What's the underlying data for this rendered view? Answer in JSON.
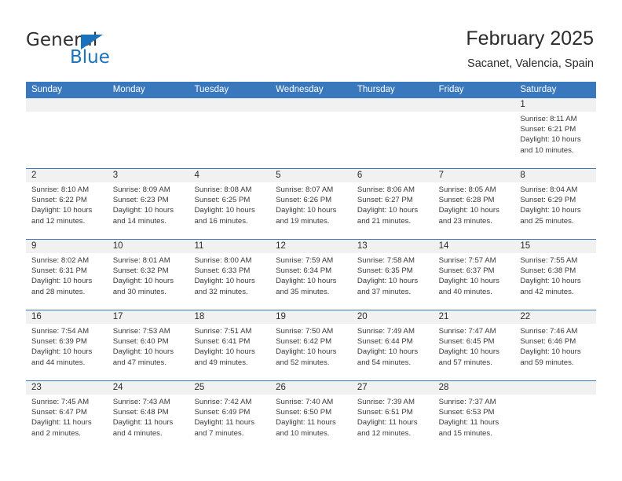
{
  "brand": {
    "name_part1": "General",
    "name_part2": "Blue",
    "triangle_color": "#1a72bb",
    "text_color": "#2f2f2f"
  },
  "header": {
    "title": "February 2025",
    "subtitle": "Sacanet, Valencia, Spain"
  },
  "colors": {
    "header_blue": "#3a78bd",
    "daynum_band": "#f1f1f1",
    "cell_background": "#ffffff",
    "text": "#3a3a3a"
  },
  "calendar": {
    "weekday_headers": [
      "Sunday",
      "Monday",
      "Tuesday",
      "Wednesday",
      "Thursday",
      "Friday",
      "Saturday"
    ],
    "weeks": [
      [
        {
          "day": "",
          "sunrise": "",
          "sunset": "",
          "daylight_line1": "",
          "daylight_line2": "",
          "empty": true
        },
        {
          "day": "",
          "sunrise": "",
          "sunset": "",
          "daylight_line1": "",
          "daylight_line2": "",
          "empty": true
        },
        {
          "day": "",
          "sunrise": "",
          "sunset": "",
          "daylight_line1": "",
          "daylight_line2": "",
          "empty": true
        },
        {
          "day": "",
          "sunrise": "",
          "sunset": "",
          "daylight_line1": "",
          "daylight_line2": "",
          "empty": true
        },
        {
          "day": "",
          "sunrise": "",
          "sunset": "",
          "daylight_line1": "",
          "daylight_line2": "",
          "empty": true
        },
        {
          "day": "",
          "sunrise": "",
          "sunset": "",
          "daylight_line1": "",
          "daylight_line2": "",
          "empty": true
        },
        {
          "day": "1",
          "sunrise": "Sunrise: 8:11 AM",
          "sunset": "Sunset: 6:21 PM",
          "daylight_line1": "Daylight: 10 hours",
          "daylight_line2": "and 10 minutes.",
          "empty": false
        }
      ],
      [
        {
          "day": "2",
          "sunrise": "Sunrise: 8:10 AM",
          "sunset": "Sunset: 6:22 PM",
          "daylight_line1": "Daylight: 10 hours",
          "daylight_line2": "and 12 minutes.",
          "empty": false
        },
        {
          "day": "3",
          "sunrise": "Sunrise: 8:09 AM",
          "sunset": "Sunset: 6:23 PM",
          "daylight_line1": "Daylight: 10 hours",
          "daylight_line2": "and 14 minutes.",
          "empty": false
        },
        {
          "day": "4",
          "sunrise": "Sunrise: 8:08 AM",
          "sunset": "Sunset: 6:25 PM",
          "daylight_line1": "Daylight: 10 hours",
          "daylight_line2": "and 16 minutes.",
          "empty": false
        },
        {
          "day": "5",
          "sunrise": "Sunrise: 8:07 AM",
          "sunset": "Sunset: 6:26 PM",
          "daylight_line1": "Daylight: 10 hours",
          "daylight_line2": "and 19 minutes.",
          "empty": false
        },
        {
          "day": "6",
          "sunrise": "Sunrise: 8:06 AM",
          "sunset": "Sunset: 6:27 PM",
          "daylight_line1": "Daylight: 10 hours",
          "daylight_line2": "and 21 minutes.",
          "empty": false
        },
        {
          "day": "7",
          "sunrise": "Sunrise: 8:05 AM",
          "sunset": "Sunset: 6:28 PM",
          "daylight_line1": "Daylight: 10 hours",
          "daylight_line2": "and 23 minutes.",
          "empty": false
        },
        {
          "day": "8",
          "sunrise": "Sunrise: 8:04 AM",
          "sunset": "Sunset: 6:29 PM",
          "daylight_line1": "Daylight: 10 hours",
          "daylight_line2": "and 25 minutes.",
          "empty": false
        }
      ],
      [
        {
          "day": "9",
          "sunrise": "Sunrise: 8:02 AM",
          "sunset": "Sunset: 6:31 PM",
          "daylight_line1": "Daylight: 10 hours",
          "daylight_line2": "and 28 minutes.",
          "empty": false
        },
        {
          "day": "10",
          "sunrise": "Sunrise: 8:01 AM",
          "sunset": "Sunset: 6:32 PM",
          "daylight_line1": "Daylight: 10 hours",
          "daylight_line2": "and 30 minutes.",
          "empty": false
        },
        {
          "day": "11",
          "sunrise": "Sunrise: 8:00 AM",
          "sunset": "Sunset: 6:33 PM",
          "daylight_line1": "Daylight: 10 hours",
          "daylight_line2": "and 32 minutes.",
          "empty": false
        },
        {
          "day": "12",
          "sunrise": "Sunrise: 7:59 AM",
          "sunset": "Sunset: 6:34 PM",
          "daylight_line1": "Daylight: 10 hours",
          "daylight_line2": "and 35 minutes.",
          "empty": false
        },
        {
          "day": "13",
          "sunrise": "Sunrise: 7:58 AM",
          "sunset": "Sunset: 6:35 PM",
          "daylight_line1": "Daylight: 10 hours",
          "daylight_line2": "and 37 minutes.",
          "empty": false
        },
        {
          "day": "14",
          "sunrise": "Sunrise: 7:57 AM",
          "sunset": "Sunset: 6:37 PM",
          "daylight_line1": "Daylight: 10 hours",
          "daylight_line2": "and 40 minutes.",
          "empty": false
        },
        {
          "day": "15",
          "sunrise": "Sunrise: 7:55 AM",
          "sunset": "Sunset: 6:38 PM",
          "daylight_line1": "Daylight: 10 hours",
          "daylight_line2": "and 42 minutes.",
          "empty": false
        }
      ],
      [
        {
          "day": "16",
          "sunrise": "Sunrise: 7:54 AM",
          "sunset": "Sunset: 6:39 PM",
          "daylight_line1": "Daylight: 10 hours",
          "daylight_line2": "and 44 minutes.",
          "empty": false
        },
        {
          "day": "17",
          "sunrise": "Sunrise: 7:53 AM",
          "sunset": "Sunset: 6:40 PM",
          "daylight_line1": "Daylight: 10 hours",
          "daylight_line2": "and 47 minutes.",
          "empty": false
        },
        {
          "day": "18",
          "sunrise": "Sunrise: 7:51 AM",
          "sunset": "Sunset: 6:41 PM",
          "daylight_line1": "Daylight: 10 hours",
          "daylight_line2": "and 49 minutes.",
          "empty": false
        },
        {
          "day": "19",
          "sunrise": "Sunrise: 7:50 AM",
          "sunset": "Sunset: 6:42 PM",
          "daylight_line1": "Daylight: 10 hours",
          "daylight_line2": "and 52 minutes.",
          "empty": false
        },
        {
          "day": "20",
          "sunrise": "Sunrise: 7:49 AM",
          "sunset": "Sunset: 6:44 PM",
          "daylight_line1": "Daylight: 10 hours",
          "daylight_line2": "and 54 minutes.",
          "empty": false
        },
        {
          "day": "21",
          "sunrise": "Sunrise: 7:47 AM",
          "sunset": "Sunset: 6:45 PM",
          "daylight_line1": "Daylight: 10 hours",
          "daylight_line2": "and 57 minutes.",
          "empty": false
        },
        {
          "day": "22",
          "sunrise": "Sunrise: 7:46 AM",
          "sunset": "Sunset: 6:46 PM",
          "daylight_line1": "Daylight: 10 hours",
          "daylight_line2": "and 59 minutes.",
          "empty": false
        }
      ],
      [
        {
          "day": "23",
          "sunrise": "Sunrise: 7:45 AM",
          "sunset": "Sunset: 6:47 PM",
          "daylight_line1": "Daylight: 11 hours",
          "daylight_line2": "and 2 minutes.",
          "empty": false
        },
        {
          "day": "24",
          "sunrise": "Sunrise: 7:43 AM",
          "sunset": "Sunset: 6:48 PM",
          "daylight_line1": "Daylight: 11 hours",
          "daylight_line2": "and 4 minutes.",
          "empty": false
        },
        {
          "day": "25",
          "sunrise": "Sunrise: 7:42 AM",
          "sunset": "Sunset: 6:49 PM",
          "daylight_line1": "Daylight: 11 hours",
          "daylight_line2": "and 7 minutes.",
          "empty": false
        },
        {
          "day": "26",
          "sunrise": "Sunrise: 7:40 AM",
          "sunset": "Sunset: 6:50 PM",
          "daylight_line1": "Daylight: 11 hours",
          "daylight_line2": "and 10 minutes.",
          "empty": false
        },
        {
          "day": "27",
          "sunrise": "Sunrise: 7:39 AM",
          "sunset": "Sunset: 6:51 PM",
          "daylight_line1": "Daylight: 11 hours",
          "daylight_line2": "and 12 minutes.",
          "empty": false
        },
        {
          "day": "28",
          "sunrise": "Sunrise: 7:37 AM",
          "sunset": "Sunset: 6:53 PM",
          "daylight_line1": "Daylight: 11 hours",
          "daylight_line2": "and 15 minutes.",
          "empty": false
        },
        {
          "day": "",
          "sunrise": "",
          "sunset": "",
          "daylight_line1": "",
          "daylight_line2": "",
          "empty": true
        }
      ]
    ]
  }
}
